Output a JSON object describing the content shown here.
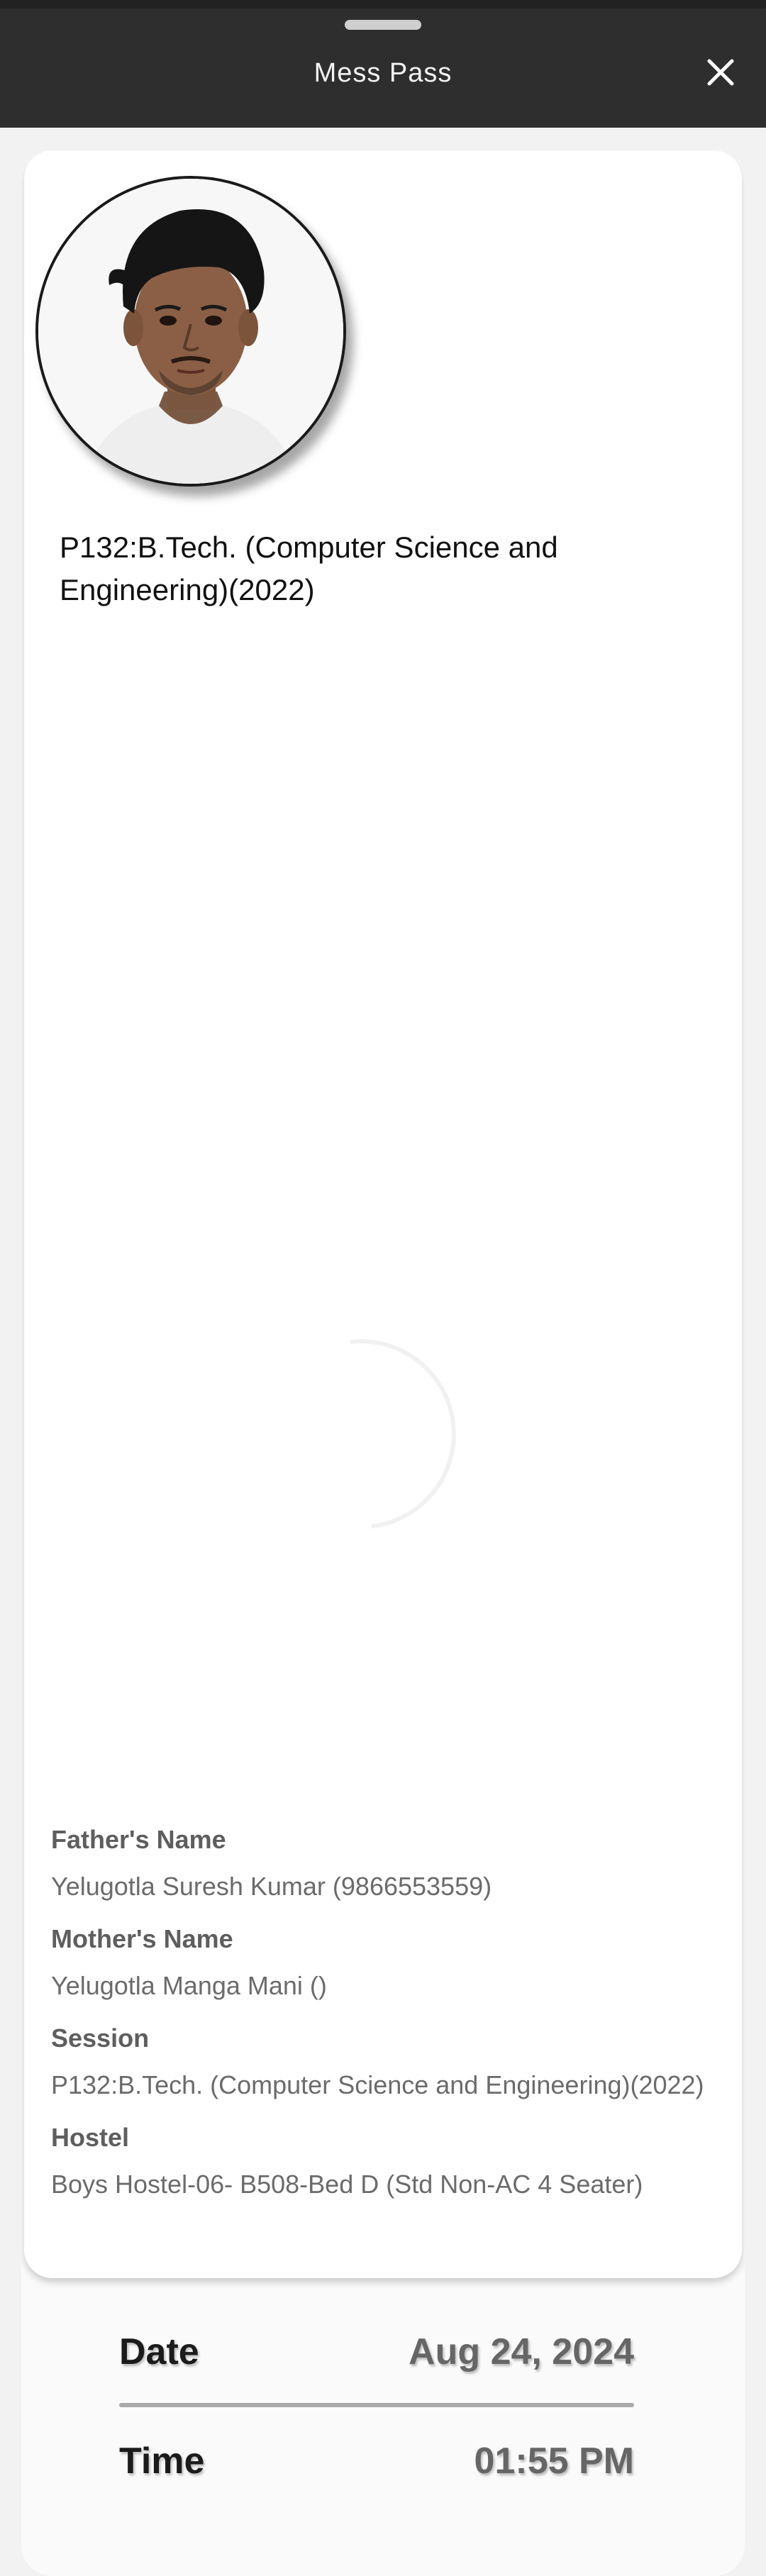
{
  "header": {
    "title": "Mess Pass",
    "close_icon": "close-icon"
  },
  "profile": {
    "photo_icon": "student-photo",
    "program": "P132:B.Tech. (Computer Science and Engineering)(2022)"
  },
  "details": {
    "father_label": "Father's Name",
    "father_value": "Yelugotla Suresh Kumar (9866553559)",
    "mother_label": "Mother's Name",
    "mother_value": "Yelugotla Manga Mani ()",
    "session_label": "Session",
    "session_value": "P132:B.Tech. (Computer Science and Engineering)(2022)",
    "hostel_label": "Hostel",
    "hostel_value": "Boys Hostel-06- B508-Bed D (Std Non-AC 4 Seater)"
  },
  "pass": {
    "date_label": "Date",
    "date_value": "Aug 24, 2024",
    "time_label": "Time",
    "time_value": "01:55 PM"
  },
  "colors": {
    "topbar": "#2e2e2e",
    "card": "#ffffff",
    "page": "#fafafa"
  }
}
